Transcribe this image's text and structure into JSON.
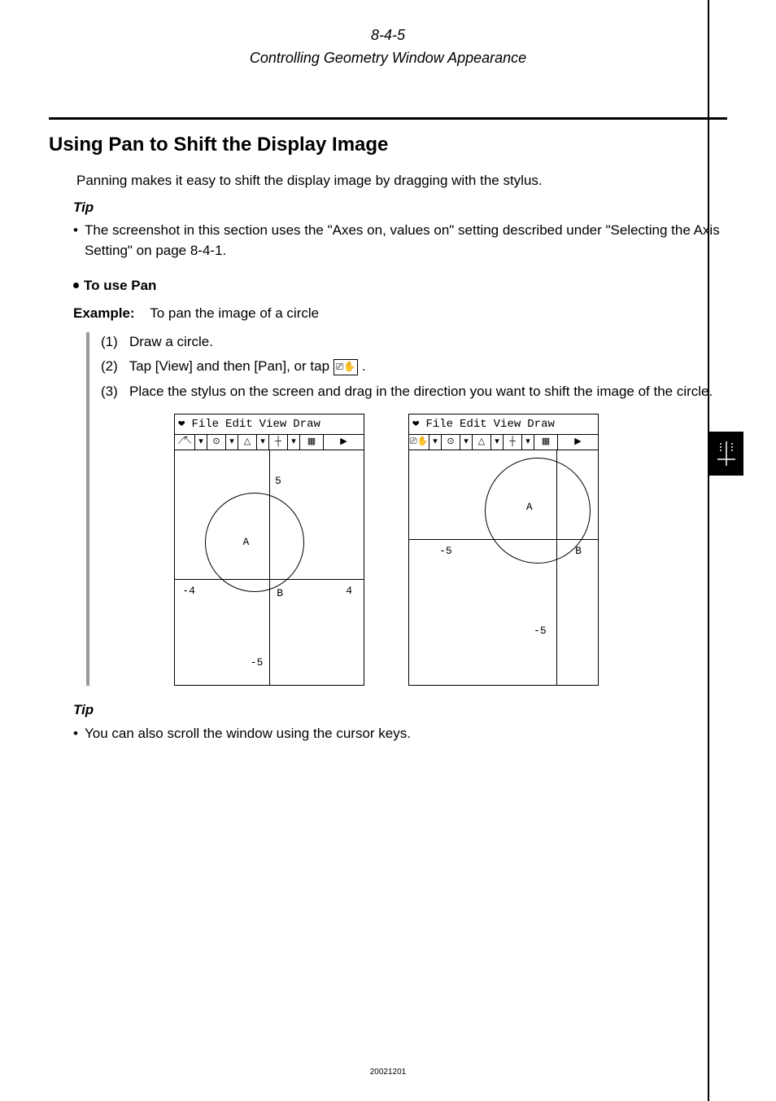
{
  "header": {
    "section_number": "8-4-5",
    "section_title": "Controlling Geometry Window Appearance"
  },
  "heading": "Using Pan to Shift the Display Image",
  "intro": "Panning makes it easy to shift the display image by dragging with the stylus.",
  "tip1_label": "Tip",
  "tip1_bullet": "•",
  "tip1_text": "The screenshot in this section uses the \"Axes on, values on\" setting described under \"Selecting the Axis Setting\" on page 8-4-1.",
  "subheading": "To use Pan",
  "example_label": "Example:",
  "example_text": "To pan the image of a circle",
  "steps": {
    "s1_num": "(1)",
    "s1_text": "Draw a circle.",
    "s2_num": "(2)",
    "s2_pre": "Tap [View] and then [Pan], or tap ",
    "s2_icon": "⎚✋",
    "s2_post": ".",
    "s3_num": "(3)",
    "s3_text": "Place the stylus on the screen and drag in the direction you want to shift the image of the circle."
  },
  "calc_menu": {
    "file": "File",
    "edit": "Edit",
    "view": "View",
    "draw": "Draw"
  },
  "calc1": {
    "ticks": {
      "top": "5",
      "right": "4",
      "left": "-4",
      "bottom": "-5"
    },
    "points": {
      "a": "A",
      "b": "B"
    }
  },
  "calc2": {
    "ticks": {
      "left": "-5",
      "bottom": "-5"
    },
    "points": {
      "a": "A",
      "b": "B"
    }
  },
  "tip2_label": "Tip",
  "tip2_bullet": "•",
  "tip2_text": "You can also scroll the window using the cursor keys.",
  "footer": "20021201"
}
